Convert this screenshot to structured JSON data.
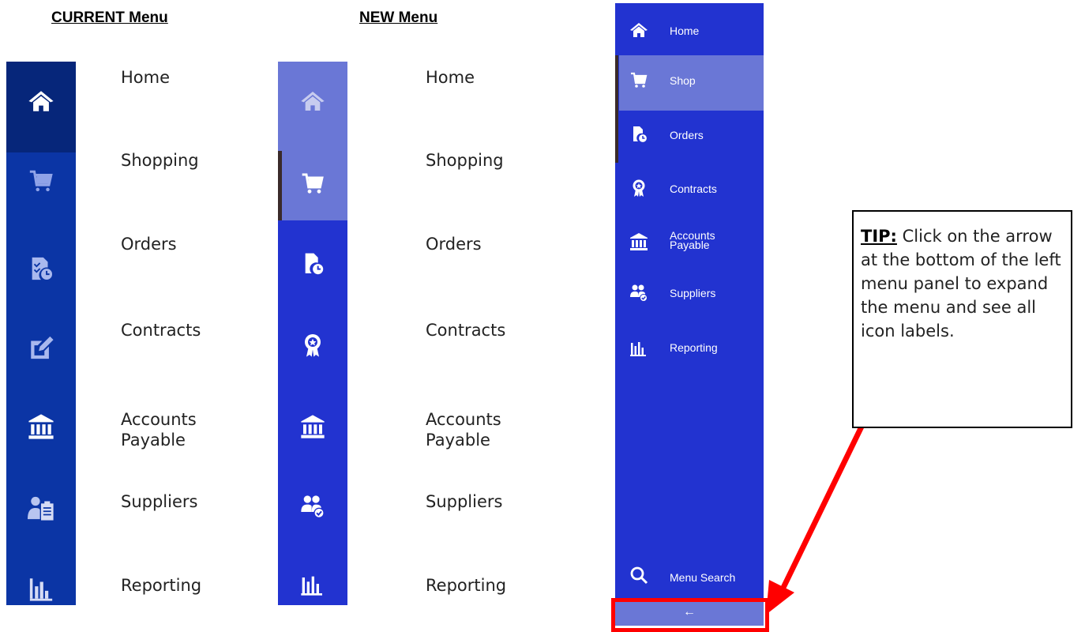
{
  "headings": {
    "current": "CURRENT Menu",
    "new": "NEW Menu"
  },
  "labels": {
    "home": "Home",
    "shopping": "Shopping",
    "orders": "Orders",
    "contracts": "Contracts",
    "accounts_line1": "Accounts",
    "accounts_line2": "Payable",
    "suppliers": "Suppliers",
    "reporting": "Reporting"
  },
  "expanded_menu": {
    "items": [
      {
        "label": "Home",
        "icon": "home-icon"
      },
      {
        "label": "Shop",
        "icon": "cart-icon",
        "active": true
      },
      {
        "label": "Orders",
        "icon": "order-clock-icon"
      },
      {
        "label": "Contracts",
        "icon": "award-ribbon-icon"
      },
      {
        "label_line1": "Accounts",
        "label_line2": "Payable",
        "icon": "bank-icon"
      },
      {
        "label": "Suppliers",
        "icon": "users-check-icon"
      },
      {
        "label": "Reporting",
        "icon": "bar-chart-icon"
      }
    ],
    "search_label": "Menu Search",
    "collapse_arrow": "←"
  },
  "tip": {
    "prefix": "TIP:",
    "text": " Click on the arrow at the bottom of the left menu panel to expand the menu and see all icon labels."
  },
  "colors": {
    "current_bar": "#0b35a5",
    "current_home": "#06267a",
    "new_bar": "#2233d0",
    "new_highlight": "#6a77d6",
    "callout": "#ff0000"
  }
}
